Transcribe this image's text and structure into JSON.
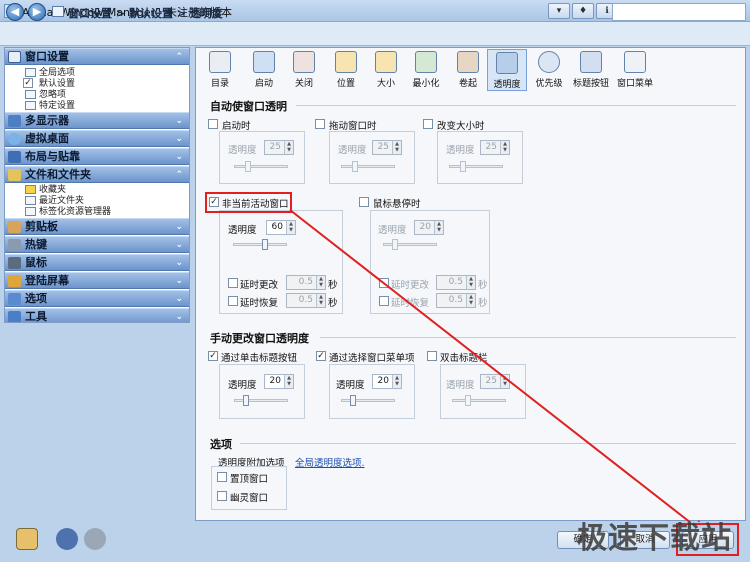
{
  "window": {
    "title": "Actual Window Manager - 未注册的版本"
  },
  "nav": {
    "breadcrumb": "窗口设置 > 默认设置 > 透明度"
  },
  "sidebar": {
    "window_settings": "窗口设置",
    "items": [
      "全局选项",
      "默认设置",
      "忽略项",
      "特定设置"
    ],
    "multi_display": "多显示器",
    "virtual_desktop": "虚拟桌面",
    "layout_snap": "布局与贴靠",
    "files_folders": "文件和文件夹",
    "ff_items": [
      "收藏夹",
      "最近文件夹",
      "标签化资源管理器"
    ],
    "clipboard": "剪贴板",
    "hotkeys": "热键",
    "mouse": "鼠标",
    "login_screen": "登陆屏幕",
    "options": "选项",
    "tools": "工具"
  },
  "toolbar": [
    "目录",
    "启动",
    "关闭",
    "位置",
    "大小",
    "最小化",
    "卷起",
    "透明度",
    "优先级",
    "标题按钮",
    "窗口菜单"
  ],
  "auto": {
    "title": "自动使窗口透明",
    "startup": "启动时",
    "drag": "拖动窗口时",
    "resize": "改变大小时",
    "inactive": "非当前活动窗口",
    "hover": "鼠标悬停时",
    "opacity_label": "透明度",
    "val_startup": "25",
    "val_drag": "25",
    "val_resize": "25",
    "val_inactive": "60",
    "val_hover": "20",
    "delay_change": "延时更改",
    "delay_restore": "延时恢复",
    "delay_val": "0.5",
    "sec": "秒"
  },
  "manual": {
    "title": "手动更改窗口透明度",
    "title_btn": "通过单击标题按钮",
    "menu_item": "通过选择窗口菜单项",
    "dblclick": "双击标题栏",
    "val1": "20",
    "val2": "20",
    "val3": "25"
  },
  "options": {
    "title": "选项",
    "extra": "透明度附加选项",
    "link": "全局透明度选项.",
    "topmost": "置顶窗口",
    "ghost": "幽灵窗口"
  },
  "buttons": {
    "ok": "确定",
    "cancel": "取消",
    "apply": "应用"
  },
  "watermark": "极速下载站",
  "colors": {
    "accent": "#4a76b8",
    "highlight": "#e02020"
  }
}
